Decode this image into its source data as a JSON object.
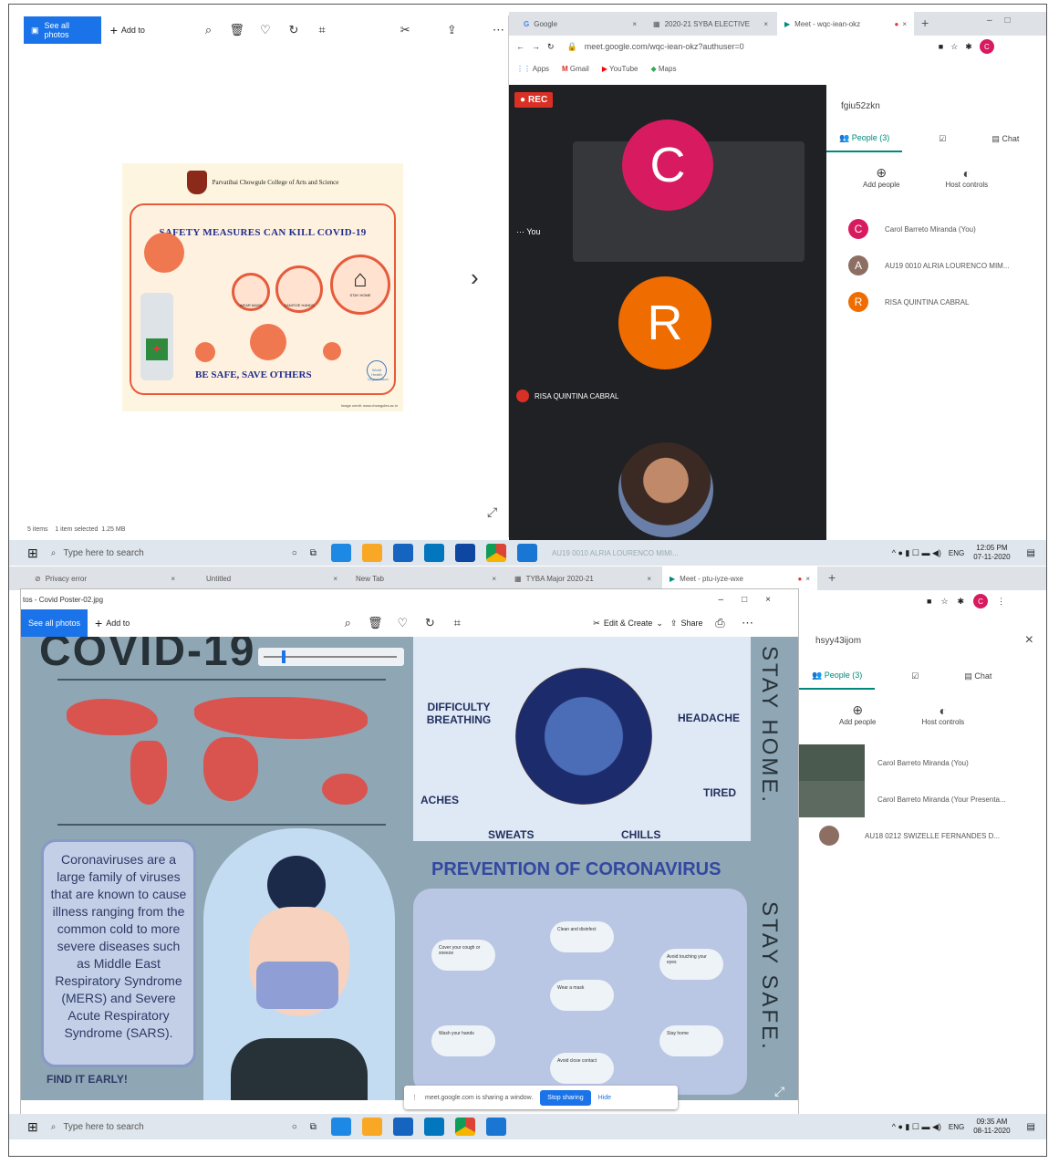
{
  "top_photos": {
    "see_all": "See all photos",
    "add_to": "Add to",
    "status": "5 items    1 item selected  1.25 MB"
  },
  "top_poster": {
    "college": "Parvatibai Chowgule College of Arts and Science",
    "college_sub": "Autonomous",
    "title": "SAFETY MEASURES CAN KILL COVID-19",
    "footer": "BE SAFE, SAVE OTHERS",
    "who": "World Health Organization",
    "circle_labels": [
      "WEAR MASK",
      "SANITIZE HANDS",
      "STAY HOME"
    ],
    "caption": "Image credit: www.chowgules.ac.in"
  },
  "top_browser": {
    "tabs": [
      "Google",
      "2020-21 SYBA ELECTIVE",
      "Meet - wqc-iean-okz"
    ],
    "url": "meet.google.com/wqc-iean-okz?authuser=0",
    "bookmarks": [
      "Apps",
      "Gmail",
      "YouTube",
      "Maps"
    ]
  },
  "top_meet": {
    "rec": "REC",
    "you": "You",
    "tile_c": "C",
    "tile_r": "R",
    "risa_name": "RISA QUINTINA CABRAL",
    "code": "fgiu52zkn",
    "tabs": [
      "People (3)",
      "Chat"
    ],
    "add_people": "Add people",
    "host_controls": "Host controls",
    "people": [
      {
        "initial": "C",
        "name": "Carol Barreto Miranda (You)",
        "color": "#d81b60"
      },
      {
        "initial": "A",
        "name": "AU19 0010 ALRIA LOURENCO MIM...",
        "color": "#8d6e63"
      },
      {
        "initial": "R",
        "name": "RISA QUINTINA CABRAL",
        "color": "#ef6c00"
      }
    ]
  },
  "taskbar1": {
    "search": "Type here to search",
    "lang": "ENG",
    "time": "12:05 PM",
    "date": "07-11-2020",
    "meet_note": "AU19 0010 ALRIA LOURENCO MIMI..."
  },
  "bottom_browser": {
    "tabs": [
      "Privacy error",
      "Untitled",
      "New Tab",
      "TYBA Major 2020-21",
      "Meet - ptu-iyze-wxe"
    ]
  },
  "bottom_photos": {
    "title": "tos - Covid Poster-02.jpg",
    "see_all": "See all photos",
    "add_to": "Add to",
    "edit": "Edit & Create",
    "share": "Share"
  },
  "bottom_poster": {
    "heading": "COVID-19",
    "paragraph": "Coronaviruses are a large family of viruses that are known to cause illness ranging from the common cold to more severe diseases such as Middle East Respiratory Syndrome (MERS) and Severe Acute Respiratory Syndrome (SARS).",
    "find": "FIND IT EARLY!",
    "symptoms": [
      "DIFFICULTY BREATHING",
      "HEADACHE",
      "ACHES",
      "TIRED",
      "SWEATS",
      "CHILLS"
    ],
    "prevention_title": "PREVENTION OF CORONAVIRUS",
    "stay_home": "STAY HOME.",
    "stay_safe": "STAY SAFE.",
    "prevention_items": [
      "Cover your cough or sneeze",
      "Clean and disinfect",
      "Avoid touching your eyes",
      "Wear a mask",
      "Wash your hands",
      "Stay home",
      "Avoid close contact"
    ]
  },
  "bottom_meet": {
    "code": "hsyy43ijom",
    "tabs": [
      "People (3)",
      "Chat"
    ],
    "add_people": "Add people",
    "host_controls": "Host controls",
    "people": [
      "Carol Barreto Miranda (You)",
      "Carol Barreto Miranda (Your Presenta...",
      "AU18 0212 SWIZELLE FERNANDES D..."
    ],
    "sharing": "meet.google.com is sharing a window.",
    "stop": "Stop sharing",
    "hide": "Hide"
  },
  "taskbar2": {
    "search": "Type here to search",
    "lang": "ENG",
    "time": "09:35 AM",
    "date": "08-11-2020"
  },
  "colors": {
    "blue": "#1a73e8",
    "pink": "#d81b60",
    "orange": "#ef6c00",
    "dark": "#202124"
  }
}
